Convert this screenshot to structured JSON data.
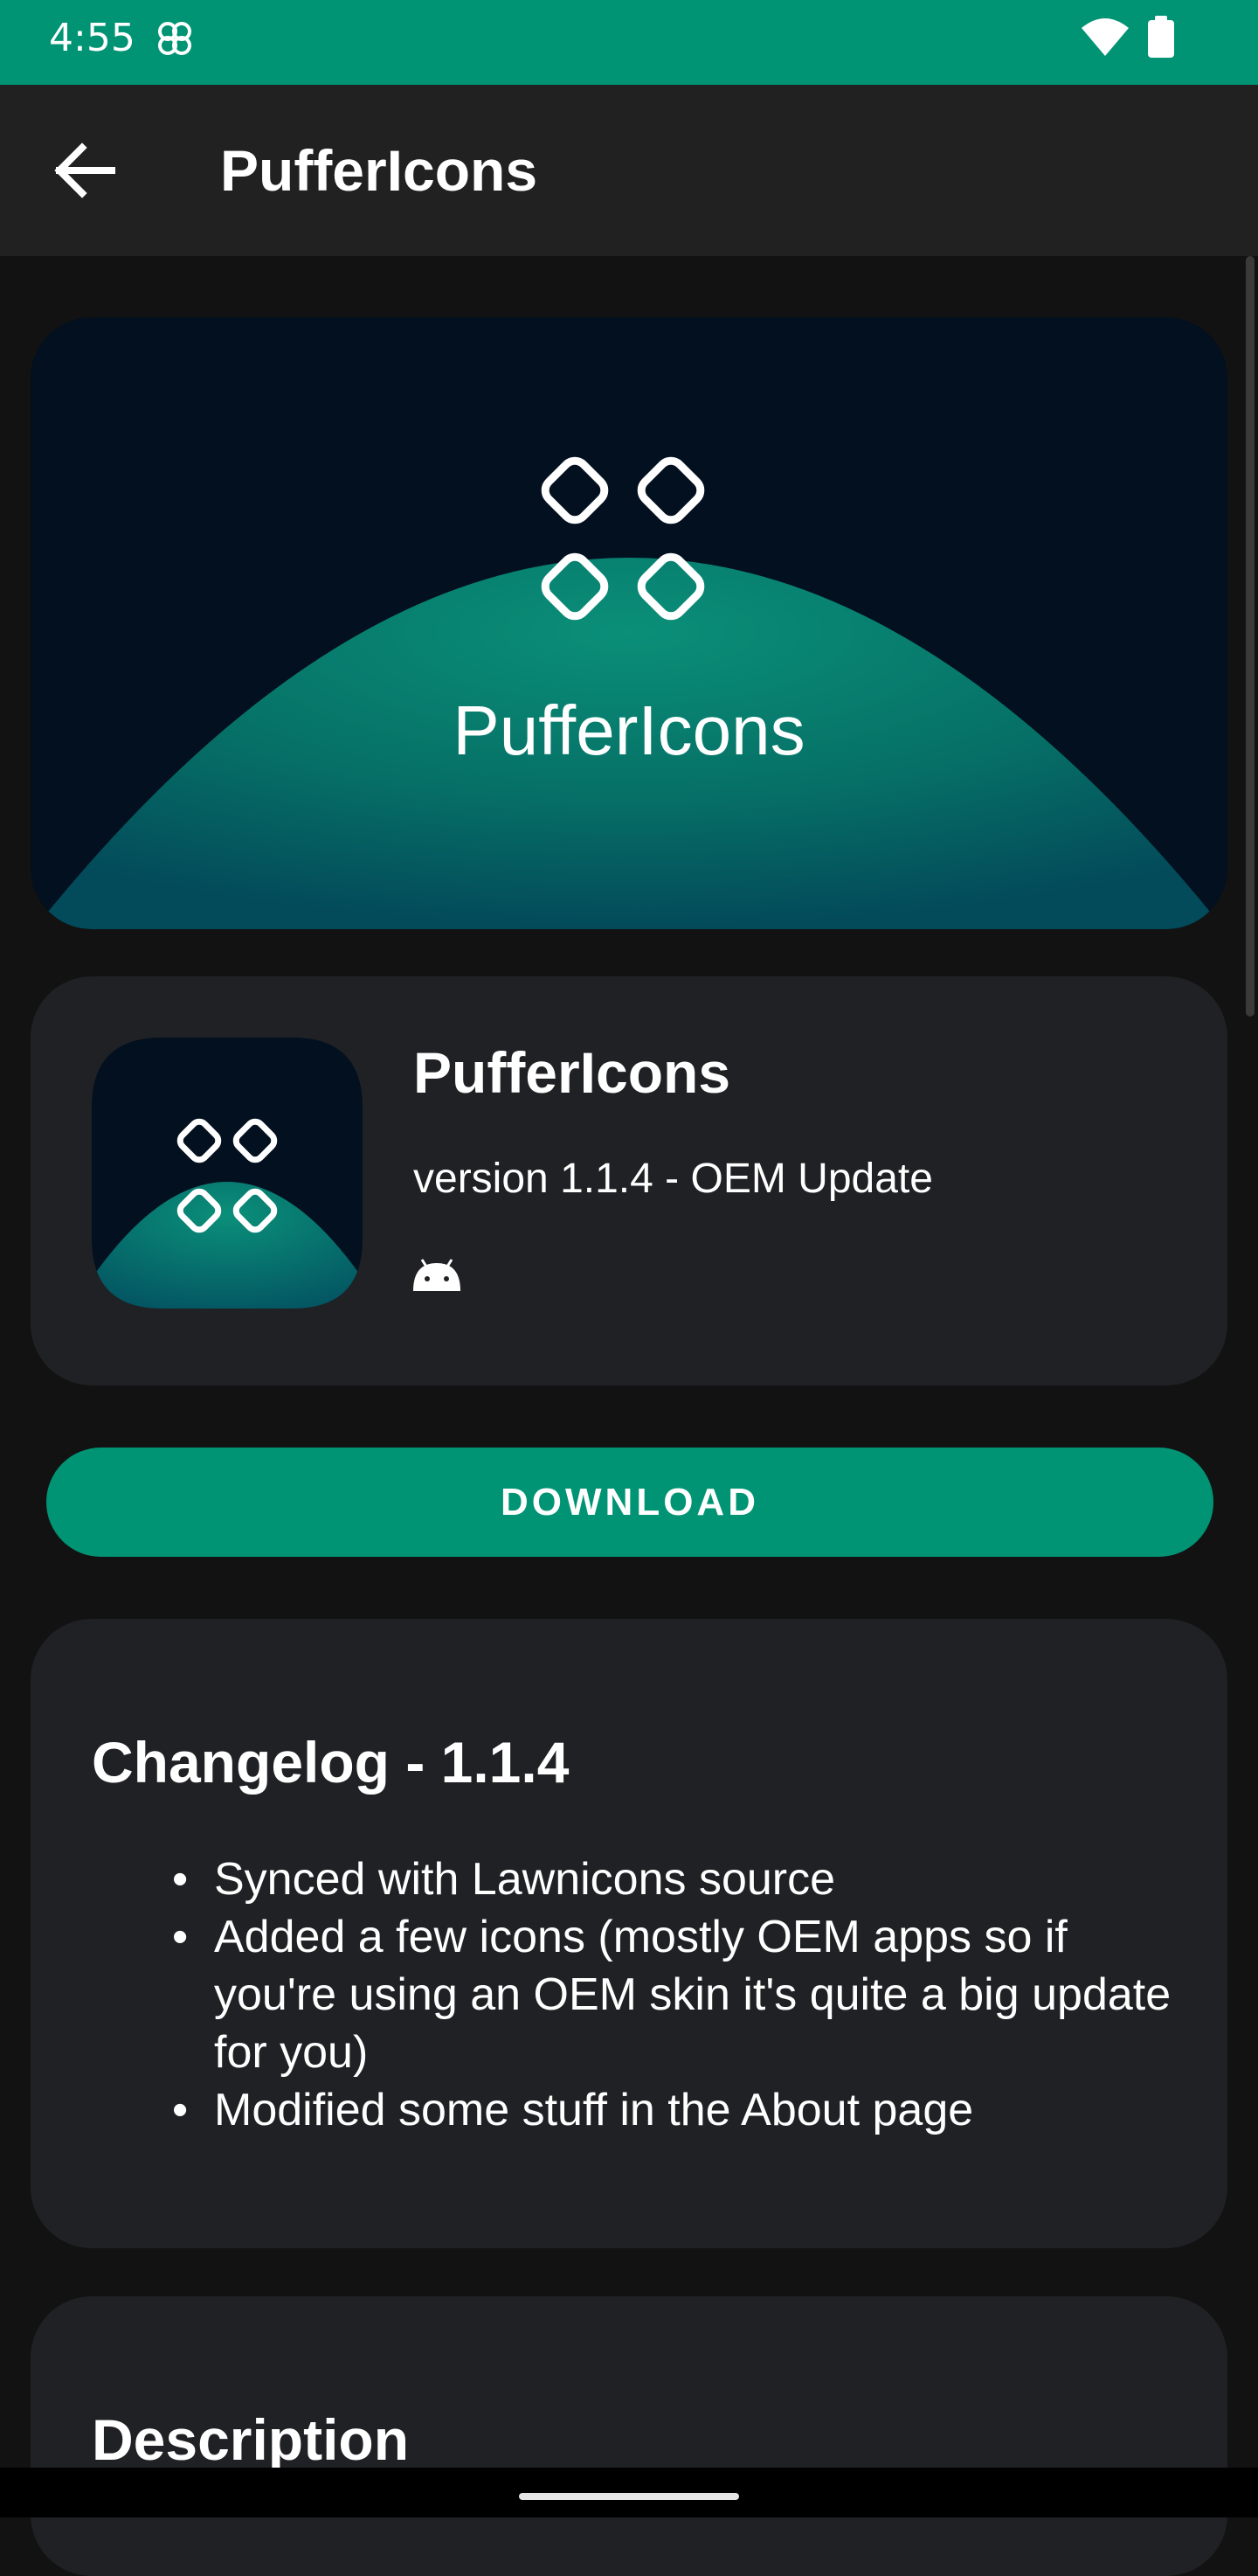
{
  "status_bar": {
    "time": "4:55",
    "background_color": "#009474",
    "icons": [
      "app-notification-icon",
      "wifi-icon",
      "battery-icon"
    ]
  },
  "app_bar": {
    "title": "PufferIcons",
    "back_icon": "arrow-back-icon"
  },
  "banner": {
    "title": "PufferIcons"
  },
  "app_info": {
    "name": "PufferIcons",
    "version": "version 1.1.4 - OEM Update",
    "platform_icon": "android-icon"
  },
  "download": {
    "label": "DOWNLOAD",
    "color": "#009474"
  },
  "changelog": {
    "title": "Changelog - 1.1.4",
    "items": [
      "Synced with Lawnicons source",
      "Added a few icons (mostly OEM apps so if you're using an OEM skin it's quite a big update for you)",
      "Modified some stuff in the About page"
    ]
  },
  "description": {
    "title": "Description"
  }
}
